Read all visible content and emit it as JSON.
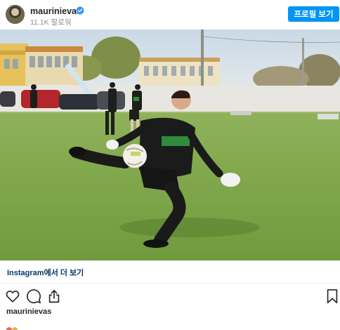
{
  "post": {
    "username": "maurinievas",
    "followers": "11.1K 팔로워",
    "profile_button": "프로필 보기",
    "more_link": "Instagram에서 더 보기",
    "owner": "maurinievas"
  },
  "colors": {
    "primary": "#0095f6",
    "link": "#00376b",
    "verified": "#3897f0",
    "grass": "#7fa64a",
    "sky": "#cfdde8"
  },
  "icons": [
    "verified-badge-icon",
    "heart-icon",
    "comment-icon",
    "share-icon",
    "bookmark-icon"
  ]
}
